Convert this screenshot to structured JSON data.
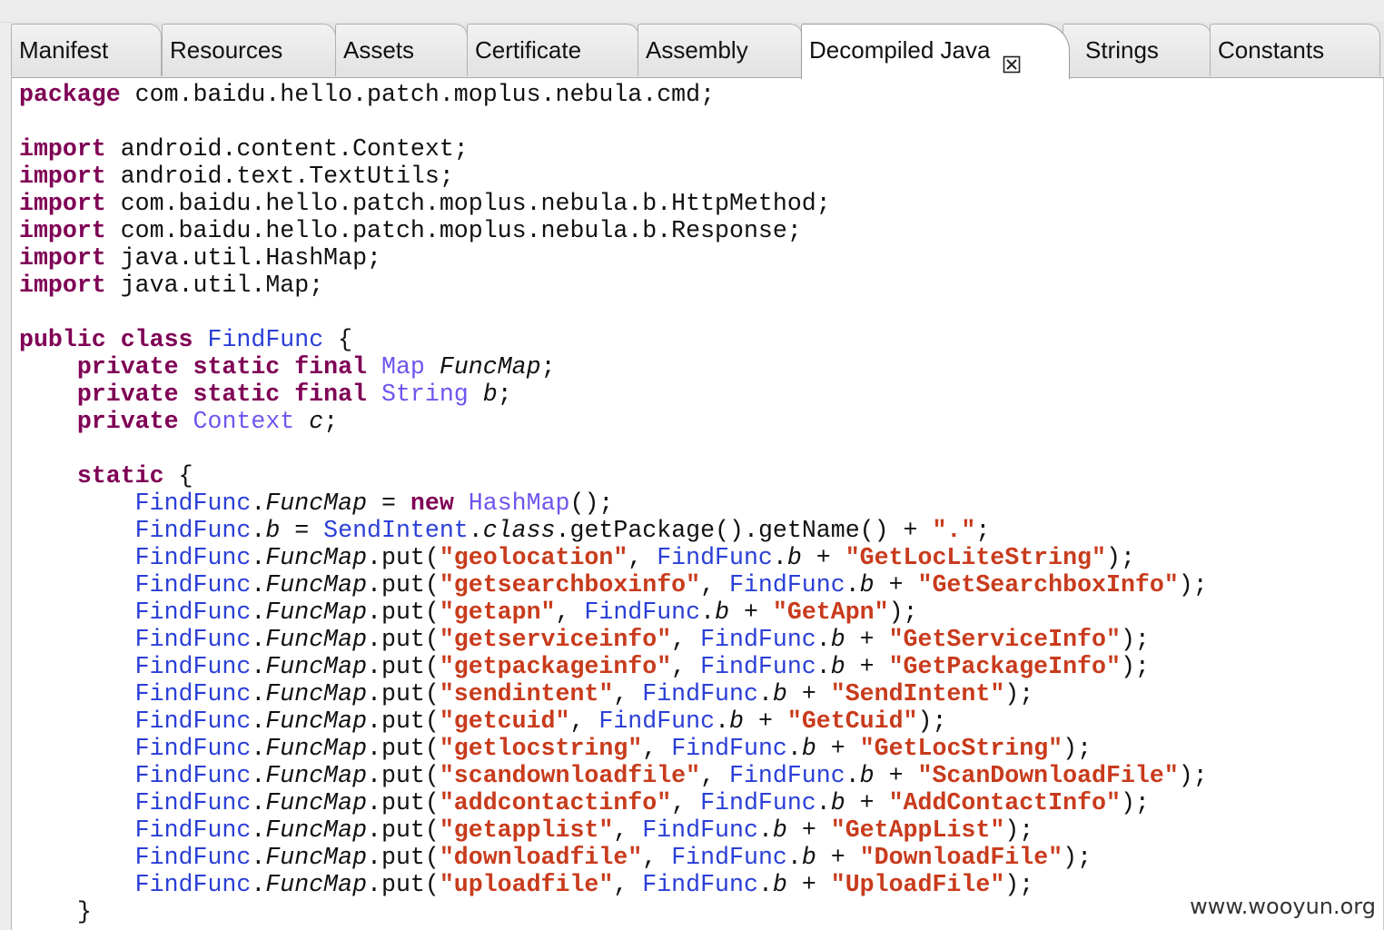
{
  "tabs": [
    {
      "label": "Manifest"
    },
    {
      "label": "Resources"
    },
    {
      "label": "Assets"
    },
    {
      "label": "Certificate"
    },
    {
      "label": "Assembly"
    },
    {
      "label": "Decompiled Java"
    },
    {
      "label": "Strings"
    },
    {
      "label": "Constants"
    }
  ],
  "active_tab": "Decompiled Java",
  "code_lines": [
    [
      {
        "t": "package",
        "c": "kw"
      },
      {
        "t": " com.baidu.hello.patch.moplus.nebula.cmd;"
      }
    ],
    [],
    [
      {
        "t": "import",
        "c": "kw"
      },
      {
        "t": " android.content.Context;"
      }
    ],
    [
      {
        "t": "import",
        "c": "kw"
      },
      {
        "t": " android.text.TextUtils;"
      }
    ],
    [
      {
        "t": "import",
        "c": "kw"
      },
      {
        "t": " com.baidu.hello.patch.moplus.nebula.b.HttpMethod;"
      }
    ],
    [
      {
        "t": "import",
        "c": "kw"
      },
      {
        "t": " com.baidu.hello.patch.moplus.nebula.b.Response;"
      }
    ],
    [
      {
        "t": "import",
        "c": "kw"
      },
      {
        "t": " java.util.HashMap;"
      }
    ],
    [
      {
        "t": "import",
        "c": "kw"
      },
      {
        "t": " java.util.Map;"
      }
    ],
    [],
    [
      {
        "t": "public class",
        "c": "kw"
      },
      {
        "t": " "
      },
      {
        "t": "FindFunc",
        "c": "cl"
      },
      {
        "t": " {"
      }
    ],
    [
      {
        "t": "    "
      },
      {
        "t": "private static final",
        "c": "kw"
      },
      {
        "t": " "
      },
      {
        "t": "Map",
        "c": "ty"
      },
      {
        "t": " "
      },
      {
        "t": "FuncMap",
        "c": "it"
      },
      {
        "t": ";"
      }
    ],
    [
      {
        "t": "    "
      },
      {
        "t": "private static final",
        "c": "kw"
      },
      {
        "t": " "
      },
      {
        "t": "String",
        "c": "ty"
      },
      {
        "t": " "
      },
      {
        "t": "b",
        "c": "it"
      },
      {
        "t": ";"
      }
    ],
    [
      {
        "t": "    "
      },
      {
        "t": "private",
        "c": "kw"
      },
      {
        "t": " "
      },
      {
        "t": "Context",
        "c": "ty"
      },
      {
        "t": " "
      },
      {
        "t": "c",
        "c": "it"
      },
      {
        "t": ";"
      }
    ],
    [],
    [
      {
        "t": "    "
      },
      {
        "t": "static",
        "c": "kw"
      },
      {
        "t": " {"
      }
    ],
    [
      {
        "t": "        "
      },
      {
        "t": "FindFunc",
        "c": "cl"
      },
      {
        "t": "."
      },
      {
        "t": "FuncMap",
        "c": "it"
      },
      {
        "t": " = "
      },
      {
        "t": "new",
        "c": "kw"
      },
      {
        "t": " "
      },
      {
        "t": "HashMap",
        "c": "ty"
      },
      {
        "t": "();"
      }
    ],
    [
      {
        "t": "        "
      },
      {
        "t": "FindFunc",
        "c": "cl"
      },
      {
        "t": "."
      },
      {
        "t": "b",
        "c": "it"
      },
      {
        "t": " = "
      },
      {
        "t": "SendIntent",
        "c": "cl"
      },
      {
        "t": "."
      },
      {
        "t": "class",
        "c": "it"
      },
      {
        "t": ".getPackage().getName() + "
      },
      {
        "t": "\".\"",
        "c": "st"
      },
      {
        "t": ";"
      }
    ],
    [
      {
        "t": "        "
      },
      {
        "t": "FindFunc",
        "c": "cl"
      },
      {
        "t": "."
      },
      {
        "t": "FuncMap",
        "c": "it"
      },
      {
        "t": ".put("
      },
      {
        "t": "\"geolocation\"",
        "c": "st"
      },
      {
        "t": ", "
      },
      {
        "t": "FindFunc",
        "c": "cl"
      },
      {
        "t": "."
      },
      {
        "t": "b",
        "c": "it"
      },
      {
        "t": " + "
      },
      {
        "t": "\"GetLocLiteString\"",
        "c": "st"
      },
      {
        "t": ");"
      }
    ],
    [
      {
        "t": "        "
      },
      {
        "t": "FindFunc",
        "c": "cl"
      },
      {
        "t": "."
      },
      {
        "t": "FuncMap",
        "c": "it"
      },
      {
        "t": ".put("
      },
      {
        "t": "\"getsearchboxinfo\"",
        "c": "st"
      },
      {
        "t": ", "
      },
      {
        "t": "FindFunc",
        "c": "cl"
      },
      {
        "t": "."
      },
      {
        "t": "b",
        "c": "it"
      },
      {
        "t": " + "
      },
      {
        "t": "\"GetSearchboxInfo\"",
        "c": "st"
      },
      {
        "t": ");"
      }
    ],
    [
      {
        "t": "        "
      },
      {
        "t": "FindFunc",
        "c": "cl"
      },
      {
        "t": "."
      },
      {
        "t": "FuncMap",
        "c": "it"
      },
      {
        "t": ".put("
      },
      {
        "t": "\"getapn\"",
        "c": "st"
      },
      {
        "t": ", "
      },
      {
        "t": "FindFunc",
        "c": "cl"
      },
      {
        "t": "."
      },
      {
        "t": "b",
        "c": "it"
      },
      {
        "t": " + "
      },
      {
        "t": "\"GetApn\"",
        "c": "st"
      },
      {
        "t": ");"
      }
    ],
    [
      {
        "t": "        "
      },
      {
        "t": "FindFunc",
        "c": "cl"
      },
      {
        "t": "."
      },
      {
        "t": "FuncMap",
        "c": "it"
      },
      {
        "t": ".put("
      },
      {
        "t": "\"getserviceinfo\"",
        "c": "st"
      },
      {
        "t": ", "
      },
      {
        "t": "FindFunc",
        "c": "cl"
      },
      {
        "t": "."
      },
      {
        "t": "b",
        "c": "it"
      },
      {
        "t": " + "
      },
      {
        "t": "\"GetServiceInfo\"",
        "c": "st"
      },
      {
        "t": ");"
      }
    ],
    [
      {
        "t": "        "
      },
      {
        "t": "FindFunc",
        "c": "cl"
      },
      {
        "t": "."
      },
      {
        "t": "FuncMap",
        "c": "it"
      },
      {
        "t": ".put("
      },
      {
        "t": "\"getpackageinfo\"",
        "c": "st"
      },
      {
        "t": ", "
      },
      {
        "t": "FindFunc",
        "c": "cl"
      },
      {
        "t": "."
      },
      {
        "t": "b",
        "c": "it"
      },
      {
        "t": " + "
      },
      {
        "t": "\"GetPackageInfo\"",
        "c": "st"
      },
      {
        "t": ");"
      }
    ],
    [
      {
        "t": "        "
      },
      {
        "t": "FindFunc",
        "c": "cl"
      },
      {
        "t": "."
      },
      {
        "t": "FuncMap",
        "c": "it"
      },
      {
        "t": ".put("
      },
      {
        "t": "\"sendintent\"",
        "c": "st"
      },
      {
        "t": ", "
      },
      {
        "t": "FindFunc",
        "c": "cl"
      },
      {
        "t": "."
      },
      {
        "t": "b",
        "c": "it"
      },
      {
        "t": " + "
      },
      {
        "t": "\"SendIntent\"",
        "c": "st"
      },
      {
        "t": ");"
      }
    ],
    [
      {
        "t": "        "
      },
      {
        "t": "FindFunc",
        "c": "cl"
      },
      {
        "t": "."
      },
      {
        "t": "FuncMap",
        "c": "it"
      },
      {
        "t": ".put("
      },
      {
        "t": "\"getcuid\"",
        "c": "st"
      },
      {
        "t": ", "
      },
      {
        "t": "FindFunc",
        "c": "cl"
      },
      {
        "t": "."
      },
      {
        "t": "b",
        "c": "it"
      },
      {
        "t": " + "
      },
      {
        "t": "\"GetCuid\"",
        "c": "st"
      },
      {
        "t": ");"
      }
    ],
    [
      {
        "t": "        "
      },
      {
        "t": "FindFunc",
        "c": "cl"
      },
      {
        "t": "."
      },
      {
        "t": "FuncMap",
        "c": "it"
      },
      {
        "t": ".put("
      },
      {
        "t": "\"getlocstring\"",
        "c": "st"
      },
      {
        "t": ", "
      },
      {
        "t": "FindFunc",
        "c": "cl"
      },
      {
        "t": "."
      },
      {
        "t": "b",
        "c": "it"
      },
      {
        "t": " + "
      },
      {
        "t": "\"GetLocString\"",
        "c": "st"
      },
      {
        "t": ");"
      }
    ],
    [
      {
        "t": "        "
      },
      {
        "t": "FindFunc",
        "c": "cl"
      },
      {
        "t": "."
      },
      {
        "t": "FuncMap",
        "c": "it"
      },
      {
        "t": ".put("
      },
      {
        "t": "\"scandownloadfile\"",
        "c": "st"
      },
      {
        "t": ", "
      },
      {
        "t": "FindFunc",
        "c": "cl"
      },
      {
        "t": "."
      },
      {
        "t": "b",
        "c": "it"
      },
      {
        "t": " + "
      },
      {
        "t": "\"ScanDownloadFile\"",
        "c": "st"
      },
      {
        "t": ");"
      }
    ],
    [
      {
        "t": "        "
      },
      {
        "t": "FindFunc",
        "c": "cl"
      },
      {
        "t": "."
      },
      {
        "t": "FuncMap",
        "c": "it"
      },
      {
        "t": ".put("
      },
      {
        "t": "\"addcontactinfo\"",
        "c": "st"
      },
      {
        "t": ", "
      },
      {
        "t": "FindFunc",
        "c": "cl"
      },
      {
        "t": "."
      },
      {
        "t": "b",
        "c": "it"
      },
      {
        "t": " + "
      },
      {
        "t": "\"AddContactInfo\"",
        "c": "st"
      },
      {
        "t": ");"
      }
    ],
    [
      {
        "t": "        "
      },
      {
        "t": "FindFunc",
        "c": "cl"
      },
      {
        "t": "."
      },
      {
        "t": "FuncMap",
        "c": "it"
      },
      {
        "t": ".put("
      },
      {
        "t": "\"getapplist\"",
        "c": "st"
      },
      {
        "t": ", "
      },
      {
        "t": "FindFunc",
        "c": "cl"
      },
      {
        "t": "."
      },
      {
        "t": "b",
        "c": "it"
      },
      {
        "t": " + "
      },
      {
        "t": "\"GetAppList\"",
        "c": "st"
      },
      {
        "t": ");"
      }
    ],
    [
      {
        "t": "        "
      },
      {
        "t": "FindFunc",
        "c": "cl"
      },
      {
        "t": "."
      },
      {
        "t": "FuncMap",
        "c": "it"
      },
      {
        "t": ".put("
      },
      {
        "t": "\"downloadfile\"",
        "c": "st"
      },
      {
        "t": ", "
      },
      {
        "t": "FindFunc",
        "c": "cl"
      },
      {
        "t": "."
      },
      {
        "t": "b",
        "c": "it"
      },
      {
        "t": " + "
      },
      {
        "t": "\"DownloadFile\"",
        "c": "st"
      },
      {
        "t": ");"
      }
    ],
    [
      {
        "t": "        "
      },
      {
        "t": "FindFunc",
        "c": "cl"
      },
      {
        "t": "."
      },
      {
        "t": "FuncMap",
        "c": "it"
      },
      {
        "t": ".put("
      },
      {
        "t": "\"uploadfile\"",
        "c": "st"
      },
      {
        "t": ", "
      },
      {
        "t": "FindFunc",
        "c": "cl"
      },
      {
        "t": "."
      },
      {
        "t": "b",
        "c": "it"
      },
      {
        "t": " + "
      },
      {
        "t": "\"UploadFile\"",
        "c": "st"
      },
      {
        "t": ");"
      }
    ],
    [
      {
        "t": "    }"
      }
    ]
  ],
  "colors": {
    "keyword": "#7f0055",
    "type_name": "#6f55ee",
    "class_ref": "#2a3fd6",
    "string_literal": "#c83b1c"
  },
  "watermark": "www.wooyun.org"
}
